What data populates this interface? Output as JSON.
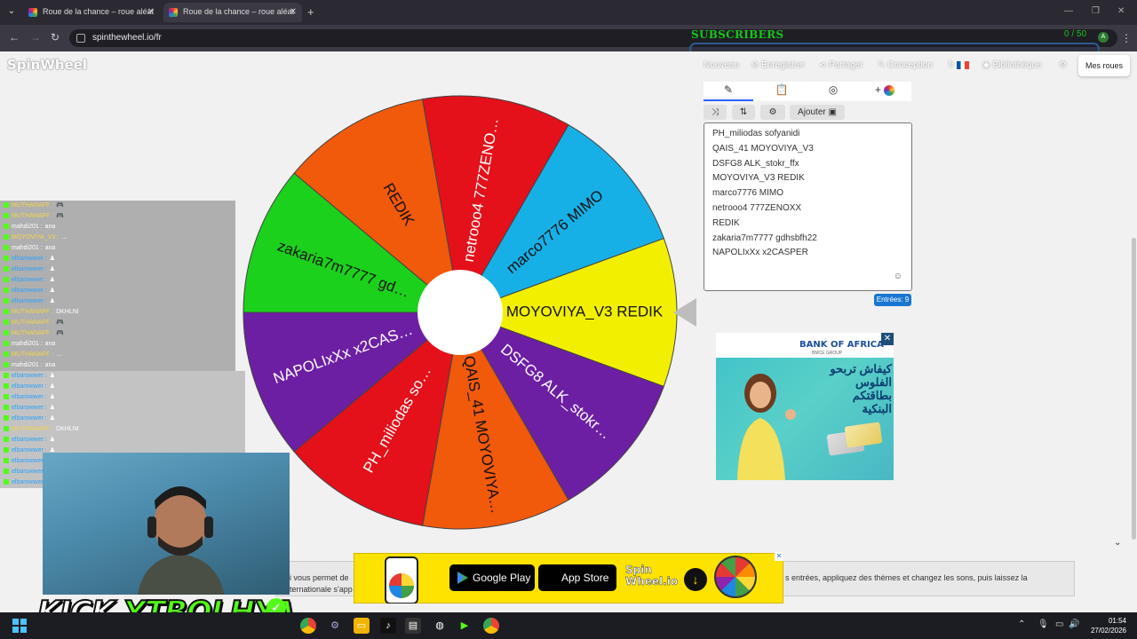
{
  "browser": {
    "tabs": [
      {
        "title": "Roue de la chance – roue aléat"
      },
      {
        "title": "Roue de la chance – roue aléat"
      }
    ],
    "url": "spinthewheel.io/fr"
  },
  "overlay": {
    "subscribers_label": "SUBSCRIBERS",
    "subscribers_count": "0 / 50",
    "avatar_letter": "A"
  },
  "site": {
    "logo": "SpinWheel",
    "nav": {
      "nouveau": "Nouveau",
      "enregistrer": "Enregistrer",
      "partager": "Partager",
      "conception": "Conception",
      "language": "fr",
      "bibliotheque": "Bibliothèque",
      "mes_roues": "Mes roues"
    }
  },
  "wheel": {
    "segments": [
      {
        "label": "MOYOVIYA_V3  REDIK",
        "color": "#f2f000",
        "text": "#111"
      },
      {
        "label": "DSFG8  ALK_stokr…",
        "color": "#6d1fa4",
        "text": "#fff"
      },
      {
        "label": "QAIS_41  MOYOVIYA…",
        "color": "#f1590b",
        "text": "#111"
      },
      {
        "label": "PH_miliodas  so…",
        "color": "#e4101a",
        "text": "#fff"
      },
      {
        "label": "NAPOLIxXx  x2CAS…",
        "color": "#6d1fa4",
        "text": "#fff"
      },
      {
        "label": "zakaria7m7777  gd…",
        "color": "#1bd11b",
        "text": "#111"
      },
      {
        "label": "REDIK",
        "color": "#f1590b",
        "text": "#111"
      },
      {
        "label": "netrooo4  777ZENO…",
        "color": "#e4101a",
        "text": "#fff"
      },
      {
        "label": "marco7776  MIMO",
        "color": "#17b0e6",
        "text": "#111"
      }
    ]
  },
  "editor": {
    "ajouter_label": "Ajouter",
    "entries": [
      "PH_miliodas    sofyanidi",
      "QAIS_41  MOYOVIYA_V3",
      "DSFG8   ALK_stokr_ffx",
      "MOYOVIYA_V3  REDIK",
      "marco7776    MIMO",
      "netrooo4  777ZENOXX",
      "REDIK",
      "zakaria7m7777  gdhsbfh22",
      "NAPOLIxXx   x2CASPER"
    ],
    "entries_count": "Entrées: 9"
  },
  "ad": {
    "brand": "BANK OF AFRICA",
    "brand_sub": "BMCE GROUP",
    "headline": "كيفاش تربحو الفلوس بطاقتكم البنكية"
  },
  "chat": {
    "rows": [
      {
        "user": "MUTHANAFF :",
        "msg": "🎮",
        "color": "yellow"
      },
      {
        "user": "MUTHANAFF :",
        "msg": "🎮",
        "color": "yellow"
      },
      {
        "user": "mahdi201 :",
        "msg": "ana",
        "color": "white"
      },
      {
        "user": "MOYOVIYA_V3 :",
        "msg": "…",
        "color": "yellow"
      },
      {
        "user": "mahdi201 :",
        "msg": "ana",
        "color": "white"
      },
      {
        "user": "elbarowwer :",
        "msg": "♟",
        "color": "blue"
      },
      {
        "user": "elbarowwer :",
        "msg": "♟",
        "color": "blue"
      },
      {
        "user": "elbarowwer :",
        "msg": "♟",
        "color": "blue"
      },
      {
        "user": "elbarowwer :",
        "msg": "♟",
        "color": "blue"
      },
      {
        "user": "elbarowwer :",
        "msg": "♟",
        "color": "blue"
      },
      {
        "user": "MUTHANAFF :",
        "msg": "DKHLNI",
        "color": "yellow"
      },
      {
        "user": "MUTHANAFF :",
        "msg": "🎮",
        "color": "yellow"
      },
      {
        "user": "MUTHANAFF :",
        "msg": "🎮",
        "color": "yellow"
      },
      {
        "user": "mahdi201 :",
        "msg": "ana",
        "color": "white"
      },
      {
        "user": "MUTHANAFF :",
        "msg": "…",
        "color": "yellow"
      },
      {
        "user": "mahdi201 :",
        "msg": "ana",
        "color": "white"
      },
      {
        "user": "elbarowwer :",
        "msg": "♟",
        "color": "blue"
      },
      {
        "user": "elbarowwer :",
        "msg": "♟",
        "color": "blue"
      },
      {
        "user": "elbarowwer :",
        "msg": "♟",
        "color": "blue"
      },
      {
        "user": "elbarowwer :",
        "msg": "♟",
        "color": "blue"
      },
      {
        "user": "elbarowwer :",
        "msg": "♟",
        "color": "blue"
      },
      {
        "user": "MUTHANAFF :",
        "msg": "DKHLNI",
        "color": "yellow"
      },
      {
        "user": "elbarowwer :",
        "msg": "♟",
        "color": "blue"
      },
      {
        "user": "elbarowwer :",
        "msg": "♟",
        "color": "blue"
      },
      {
        "user": "elbarowwer :",
        "msg": "♟",
        "color": "blue"
      },
      {
        "user": "elbarowwer :",
        "msg": "♟",
        "color": "blue"
      },
      {
        "user": "elbarowwer :",
        "msg": "♟",
        "color": "blue"
      }
    ]
  },
  "stream": {
    "platform": "KICK",
    "channel": "YTBOLHYA"
  },
  "page_text": {
    "left_1": "i vous permet de",
    "left_2": "ternationale s'app",
    "right": "s entrées, appliquez des thèmes et changez les sons, puis laissez la"
  },
  "banner": {
    "google_play": "Google Play",
    "app_store": "App Store",
    "spin_line1": "Spin",
    "spin_line2": "Wheel.io"
  },
  "taskbar": {
    "time": "01:54",
    "date": "27/02/2026"
  },
  "colors": {
    "kick_green": "#53fc18",
    "subscribers_green": "#17c51a",
    "accent_blue": "#1976d2"
  }
}
